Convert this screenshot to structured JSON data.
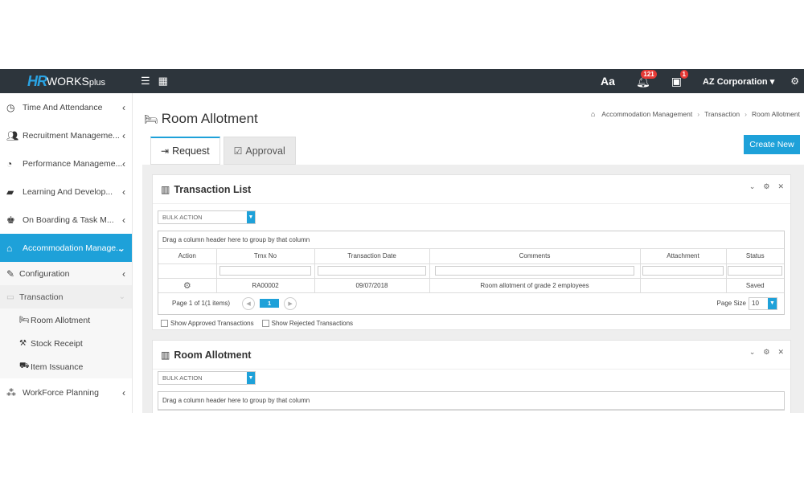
{
  "topbar": {
    "logo_hr": "HR",
    "logo_works": "WORKS",
    "logo_plus": "plus",
    "font_label": "Aa",
    "notifications_count": "121",
    "tasks_count": "1",
    "company": "AZ Corporation"
  },
  "sidebar": {
    "items": [
      {
        "label": "Time And Attendance"
      },
      {
        "label": "Recruitment Manageme..."
      },
      {
        "label": "Performance Manageme..."
      },
      {
        "label": "Learning And Develop..."
      },
      {
        "label": "On Boarding & Task M..."
      },
      {
        "label": "Accommodation Manage..."
      }
    ],
    "configuration": "Configuration",
    "transaction": "Transaction",
    "room_allotment": "Room Allotment",
    "stock_receipt": "Stock Receipt",
    "item_issuance": "Item Issuance",
    "workforce": "WorkForce Planning"
  },
  "page": {
    "title": "Room Allotment",
    "breadcrumb": [
      "Accommodation Management",
      "Transaction",
      "Room Allotment"
    ],
    "tab_request": "Request",
    "tab_approval": "Approval",
    "create_new": "Create New"
  },
  "panel1": {
    "title": "Transaction List",
    "bulk_action": "BULK ACTION",
    "group_hint": "Drag a column header here to group by that column",
    "columns": [
      "Action",
      "Trnx No",
      "Transaction Date",
      "Comments",
      "Attachment",
      "Status"
    ],
    "rows": [
      {
        "trnx_no": "RA00002",
        "date": "09/07/2018",
        "comments": "Room allotment of grade 2 employees",
        "attachment": "",
        "status": "Saved"
      }
    ],
    "pager_text": "Page 1 of 1(1 items)",
    "current_page": "1",
    "page_size_label": "Page Size",
    "page_size": "10",
    "show_approved": "Show Approved Transactions",
    "show_rejected": "Show Rejected Transactions"
  },
  "panel2": {
    "title": "Room Allotment",
    "bulk_action": "BULK ACTION",
    "group_hint": "Drag a column header here to group by that column"
  }
}
